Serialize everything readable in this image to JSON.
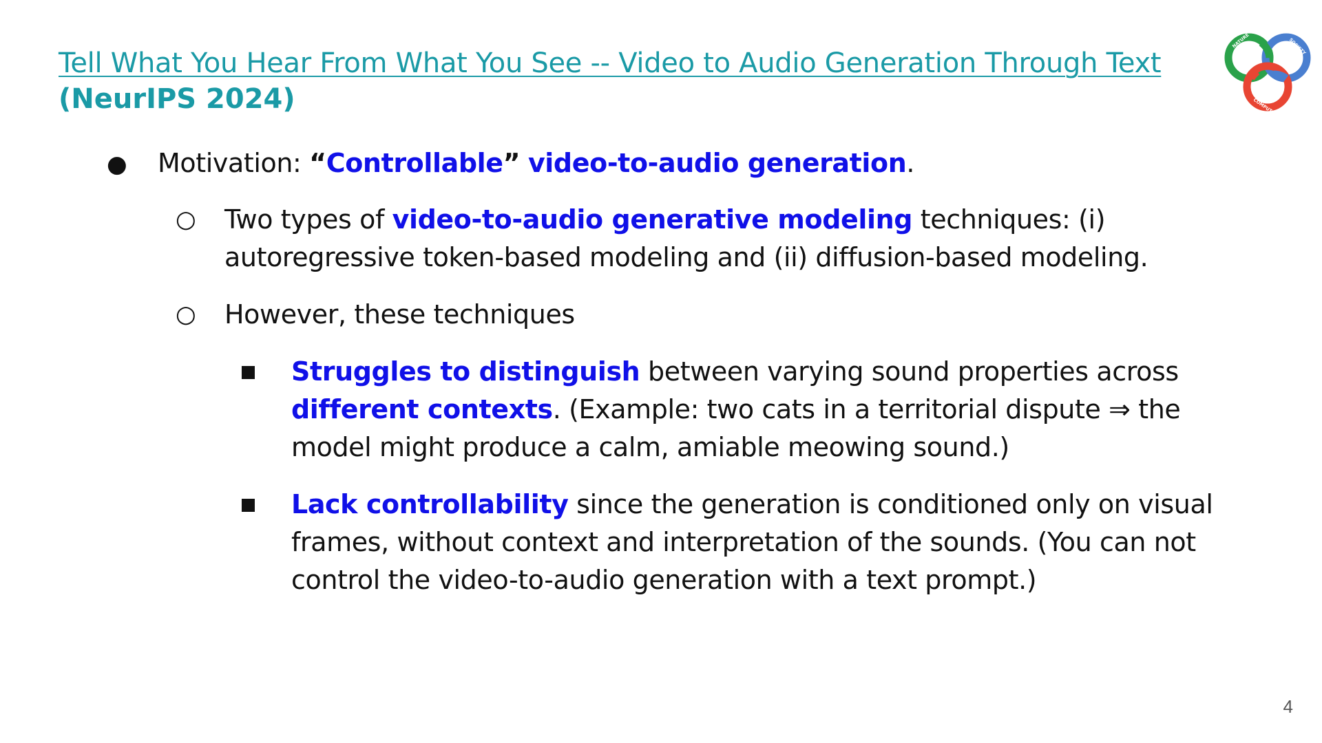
{
  "slide": {
    "title": "Tell What You Hear From What You See -- Video to Audio Generation Through Text",
    "venue": "(NeurIPS 2024)",
    "logo": {
      "icon": "trefoil-logo-icon",
      "words": [
        "NATURE",
        "SOCIETY",
        "COMPUTATION"
      ],
      "colors": {
        "green": "#2aa24a",
        "blue": "#4a7fd0",
        "red": "#e84533"
      }
    },
    "page_number": "4"
  },
  "bullets": {
    "b1": {
      "marker": "●",
      "prefix": "Motivation:  ",
      "quote_open": "“",
      "hl1": "Controllable",
      "quote_close": "”",
      "space": " ",
      "hl2": "video-to-audio generation",
      "suffix": "."
    },
    "b2": {
      "marker": "○",
      "line1_prefix": "Two types of ",
      "line1_hl": "video-to-audio generative modeling",
      "line1_suffix": " techniques: (i)",
      "line2": "autoregressive token-based modeling and (ii) diffusion-based modeling."
    },
    "b3": {
      "marker": "○",
      "text": "However, these techniques"
    },
    "b4": {
      "line1_hl": "Struggles to distinguish",
      "line1_suffix": " between varying sound properties across",
      "line2_hl": "different contexts",
      "line2_suffix": ". (Example: two cats in a territorial dispute ⇒ the",
      "line3": "model might produce a calm, amiable meowing sound.)"
    },
    "b5": {
      "line1_hl": "Lack controllability",
      "line1_suffix": " since the generation is conditioned only on visual",
      "line2": "frames, without context and interpretation of the sounds. (You can not",
      "line3": "control the video-to-audio generation with a text prompt.)"
    }
  },
  "colors": {
    "title": "#1a9aa6",
    "highlight": "#1010e8",
    "text": "#111111"
  }
}
